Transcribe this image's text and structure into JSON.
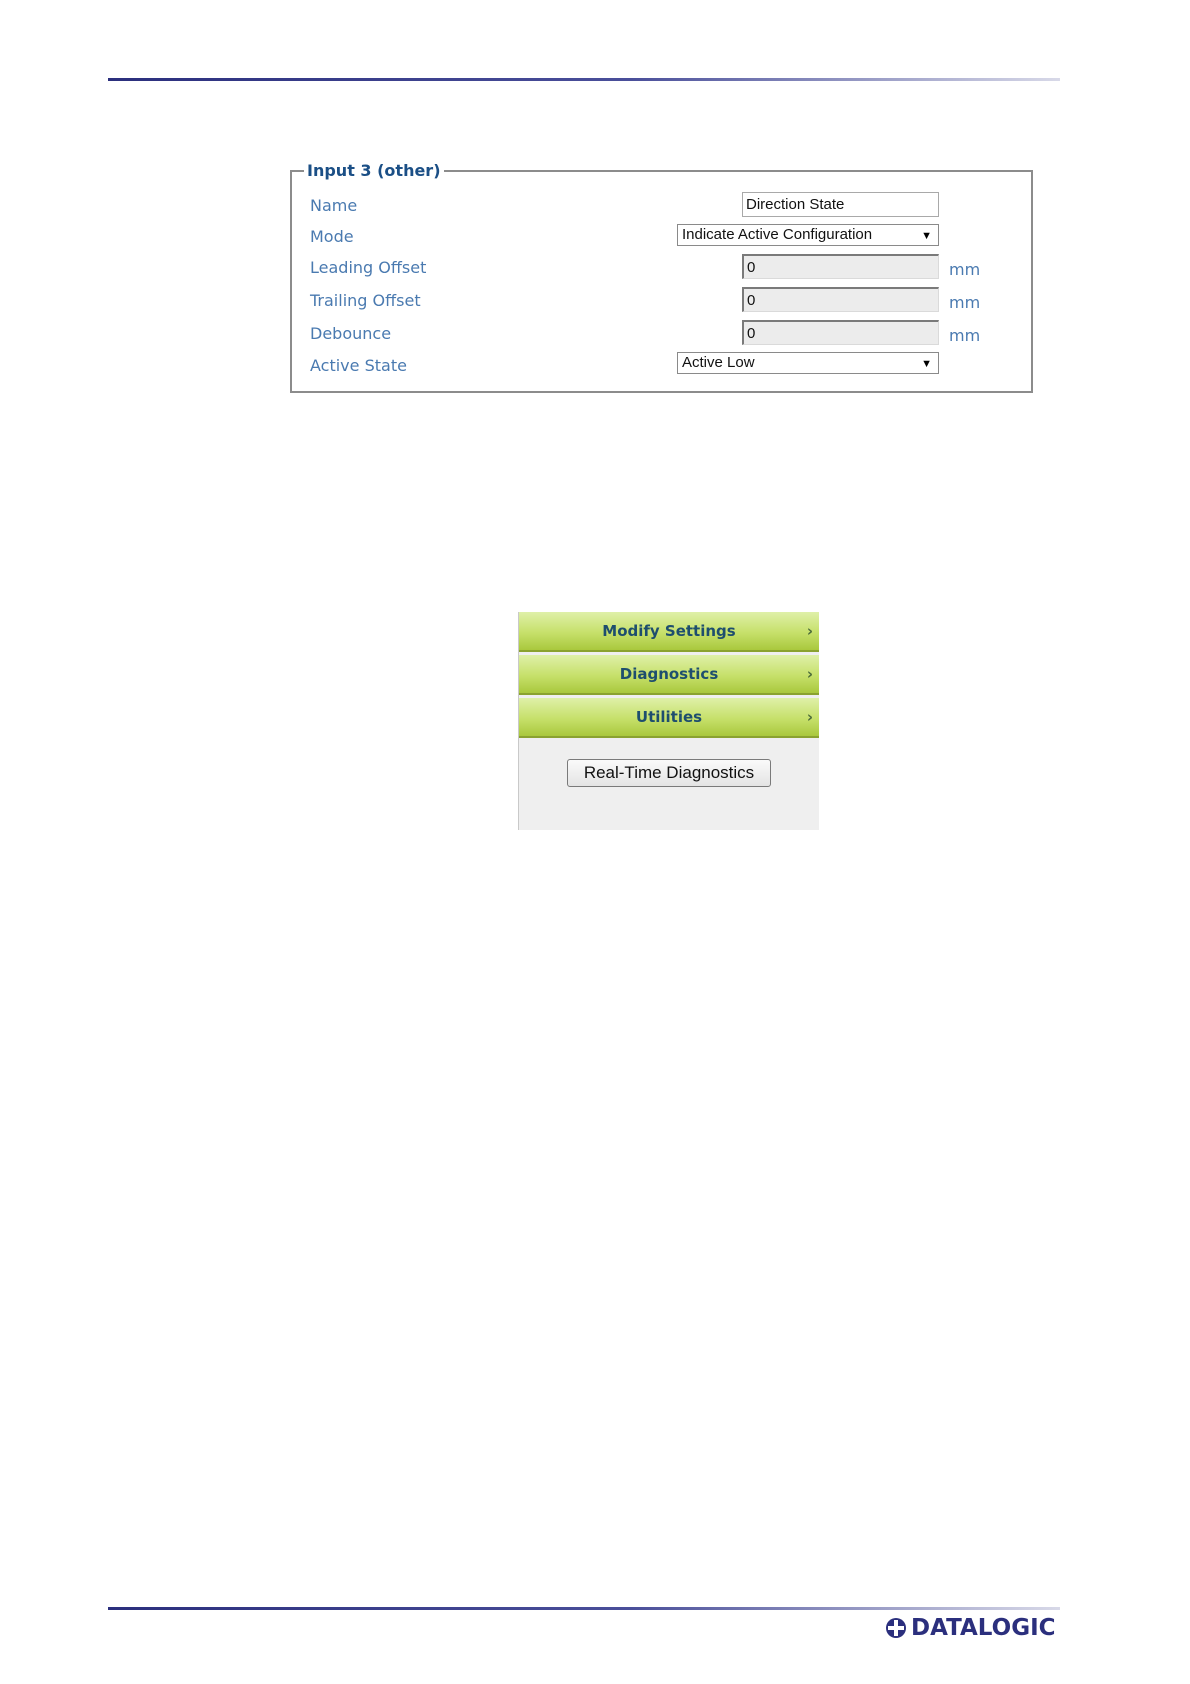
{
  "colors": {
    "header_rule": "#2b2f7d",
    "label_blue": "#4a7ab0",
    "legend_blue": "#1b4f86",
    "menu_green": "#c6e06a",
    "logo_blue": "#2b2f7d"
  },
  "form": {
    "legend": "Input 3 (other)",
    "fields": [
      {
        "label": "Name",
        "type": "text",
        "value": "Direction State"
      },
      {
        "label": "Mode",
        "type": "select",
        "value": "Indicate Active Configuration"
      },
      {
        "label": "Leading Offset",
        "type": "text",
        "value": "0",
        "unit": "mm"
      },
      {
        "label": "Trailing Offset",
        "type": "text",
        "value": "0",
        "unit": "mm"
      },
      {
        "label": "Debounce",
        "type": "text",
        "value": "0",
        "unit": "mm"
      },
      {
        "label": "Active State",
        "type": "select",
        "value": "Active Low"
      }
    ]
  },
  "menu": {
    "items": [
      {
        "label": "Modify Settings",
        "icon": "chevron-right-icon"
      },
      {
        "label": "Diagnostics",
        "icon": "chevron-right-icon"
      },
      {
        "label": "Utilities",
        "icon": "chevron-right-icon"
      }
    ],
    "button_label": "Real-Time Diagnostics"
  },
  "footer": {
    "logo_text": "DATALOGIC"
  }
}
